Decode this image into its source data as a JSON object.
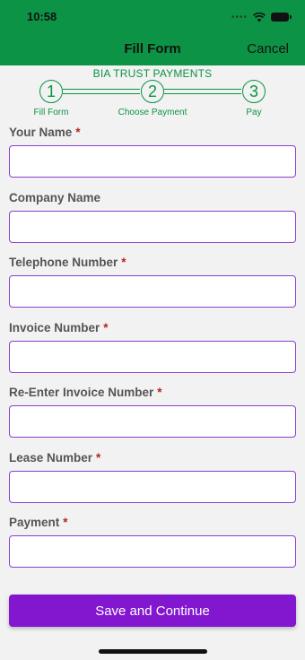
{
  "status_bar": {
    "time": "10:58"
  },
  "nav": {
    "title": "Fill Form",
    "cancel_label": "Cancel"
  },
  "brand_text": "BIA TRUST PAYMENTS",
  "steps": [
    {
      "number": "1",
      "label": "Fill Form"
    },
    {
      "number": "2",
      "label": "Choose Payment"
    },
    {
      "number": "3",
      "label": "Pay"
    }
  ],
  "fields": [
    {
      "label": "Your Name",
      "required_mark": "*",
      "value": ""
    },
    {
      "label": "Company Name",
      "required_mark": "",
      "value": ""
    },
    {
      "label": "Telephone Number",
      "required_mark": "*",
      "value": ""
    },
    {
      "label": "Invoice Number",
      "required_mark": "*",
      "value": ""
    },
    {
      "label": "Re-Enter Invoice Number",
      "required_mark": "*",
      "value": ""
    },
    {
      "label": "Lease Number",
      "required_mark": "*",
      "value": ""
    },
    {
      "label": "Payment",
      "required_mark": "*",
      "value": ""
    }
  ],
  "save_button_label": "Save and Continue",
  "colors": {
    "header": "#0d9345",
    "accent": "#8317cf",
    "input_border": "#8a3fd1",
    "required": "#b3261e"
  },
  "icons": [
    "wifi-icon",
    "battery-icon",
    "signal-dots-icon"
  ]
}
